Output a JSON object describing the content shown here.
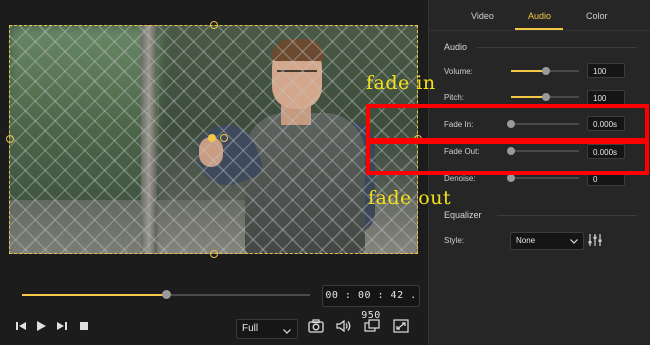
{
  "player": {
    "timecode": "00 : 00 : 42 . 950",
    "progress_fraction": 0.5,
    "zoom": "Full"
  },
  "panel": {
    "tabs": [
      {
        "label": "Video",
        "active": false
      },
      {
        "label": "Audio",
        "active": true
      },
      {
        "label": "Color",
        "active": false
      }
    ],
    "audio_section_title": "Audio",
    "rows": {
      "volume": {
        "label": "Volume:",
        "value": "100",
        "level": 0.52
      },
      "pitch": {
        "label": "Pitch:",
        "value": "100",
        "level": 0.52
      },
      "fade_in": {
        "label": "Fade In:",
        "value": "0.000s",
        "level": 0.0
      },
      "fade_out": {
        "label": "Fade Out:",
        "value": "0.000s",
        "level": 0.0
      },
      "denoise": {
        "label": "Denoise:",
        "value": "0",
        "level": 0.0
      }
    },
    "equalizer_title": "Equalizer",
    "style_label": "Style:",
    "style_value": "None"
  },
  "annotations": {
    "fade_in_text": "fade in",
    "fade_out_text": "fade out"
  },
  "colors": {
    "accent": "#f3c845",
    "annotation_red": "#ff0000",
    "annotation_yellow": "#f5e11a"
  }
}
